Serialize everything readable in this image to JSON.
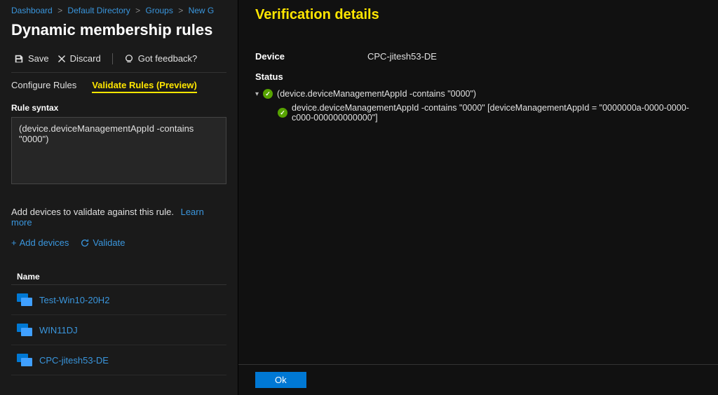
{
  "breadcrumb": {
    "items": [
      "Dashboard",
      "Default Directory",
      "Groups",
      "New G"
    ]
  },
  "pageTitle": "Dynamic membership rules",
  "toolbar": {
    "save": "Save",
    "discard": "Discard",
    "feedback": "Got feedback?"
  },
  "tabs": {
    "configure": "Configure Rules",
    "validate": "Validate Rules (Preview)"
  },
  "ruleSyntax": {
    "label": "Rule syntax",
    "value": "(device.deviceManagementAppId -contains \"0000\")"
  },
  "hint": {
    "text": "Add devices to validate against this rule.",
    "learnMore": "Learn more"
  },
  "actions": {
    "addDevices": "Add devices",
    "validate": "Validate"
  },
  "deviceTable": {
    "header": "Name",
    "items": [
      {
        "name": "Test-Win10-20H2"
      },
      {
        "name": "WIN11DJ"
      },
      {
        "name": "CPC-jitesh53-DE"
      }
    ]
  },
  "verification": {
    "title": "Verification details",
    "deviceLabel": "Device",
    "deviceValue": "CPC-jitesh53-DE",
    "statusLabel": "Status",
    "ruleExpr": "(device.deviceManagementAppId -contains \"0000\")",
    "ruleDetail": "device.deviceManagementAppId -contains \"0000\" [deviceManagementAppId = \"0000000a-0000-0000-c000-000000000000\"]",
    "okButton": "Ok"
  }
}
